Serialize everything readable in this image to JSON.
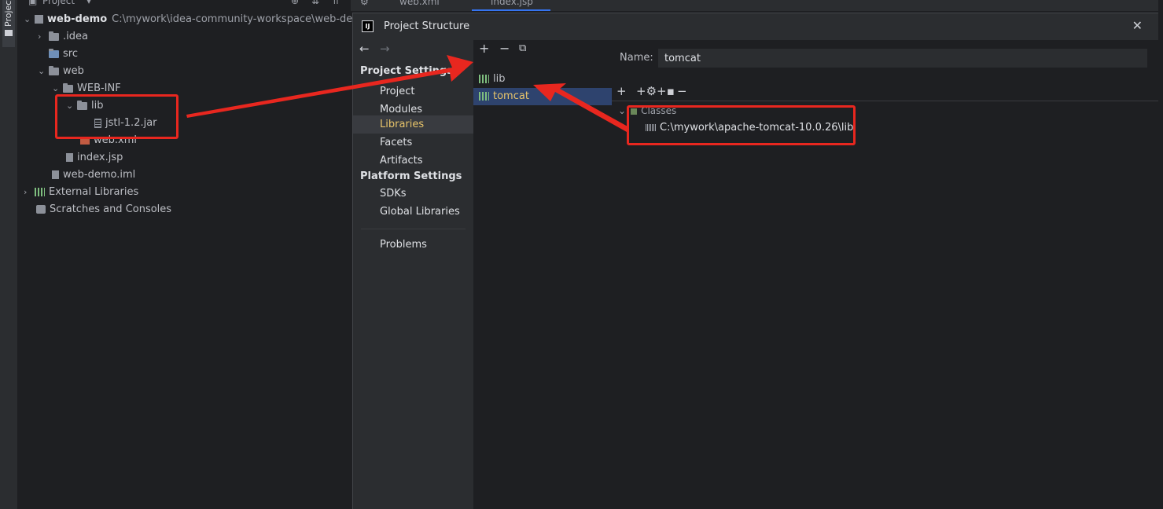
{
  "project_panel": {
    "title": "Project",
    "tree": {
      "root": {
        "name": "web-demo",
        "path": "C:\\mywork\\idea-community-workspace\\web-demo"
      },
      "idea": ".idea",
      "src": "src",
      "web": "web",
      "web_inf": "WEB-INF",
      "lib": "lib",
      "jar": "jstl-1.2.jar",
      "web_xml": "web.xml",
      "index_jsp": "index.jsp",
      "iml": "web-demo.iml",
      "external": "External Libraries",
      "scratches": "Scratches and Consoles"
    }
  },
  "strip": {
    "tab_label": "Project"
  },
  "editor_tabs": [
    "web.xml",
    "index.jsp"
  ],
  "dialog": {
    "title": "Project Structure",
    "logo": "IJ",
    "nav": {
      "project_settings_header": "Project Settings",
      "project_items": [
        "Project",
        "Modules",
        "Libraries",
        "Facets",
        "Artifacts"
      ],
      "platform_settings_header": "Platform Settings",
      "platform_items": [
        "SDKs",
        "Global Libraries"
      ],
      "problems": "Problems",
      "selected": "Libraries"
    },
    "libraries": {
      "items": [
        "lib",
        "tomcat"
      ],
      "selected": "tomcat"
    },
    "detail": {
      "name_label": "Name:",
      "name_value": "tomcat",
      "classes_label": "Classes",
      "class_path": "C:\\mywork\\apache-tomcat-10.0.26\\lib"
    }
  },
  "colors": {
    "annotation": "#e8271f",
    "selected_text": "#e8c46a",
    "selection_bg": "#2e436e"
  }
}
